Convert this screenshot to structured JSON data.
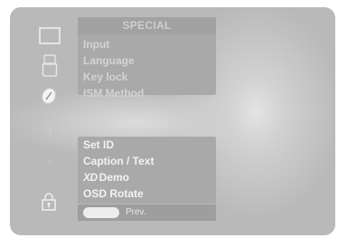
{
  "menu": {
    "title": "SPECIAL",
    "items_upper": [
      {
        "label": "Input",
        "state": "dim"
      },
      {
        "label": "Language",
        "state": "dim"
      },
      {
        "label": "Key lock",
        "state": "dim"
      },
      {
        "label": "ISM Method",
        "state": "dim"
      }
    ],
    "items_lower": [
      {
        "label": "Set ID",
        "state": "lit"
      },
      {
        "label": "Caption / Text",
        "state": "lit"
      },
      {
        "label": "Demo",
        "logo": "XD",
        "state": "lit"
      },
      {
        "label": "OSD Rotate",
        "state": "lit"
      }
    ],
    "prev_label": "Prev."
  },
  "icons": [
    "picture-icon",
    "audio-icon",
    "timer-icon",
    "option-icon",
    "screen-icon",
    "lock-icon"
  ],
  "colors": {
    "screen_bg": "#b9b9b9",
    "panel_bg": "#a9a9a9",
    "text_dim": "#d3d3d3",
    "text_lit": "#f2f2f2"
  }
}
